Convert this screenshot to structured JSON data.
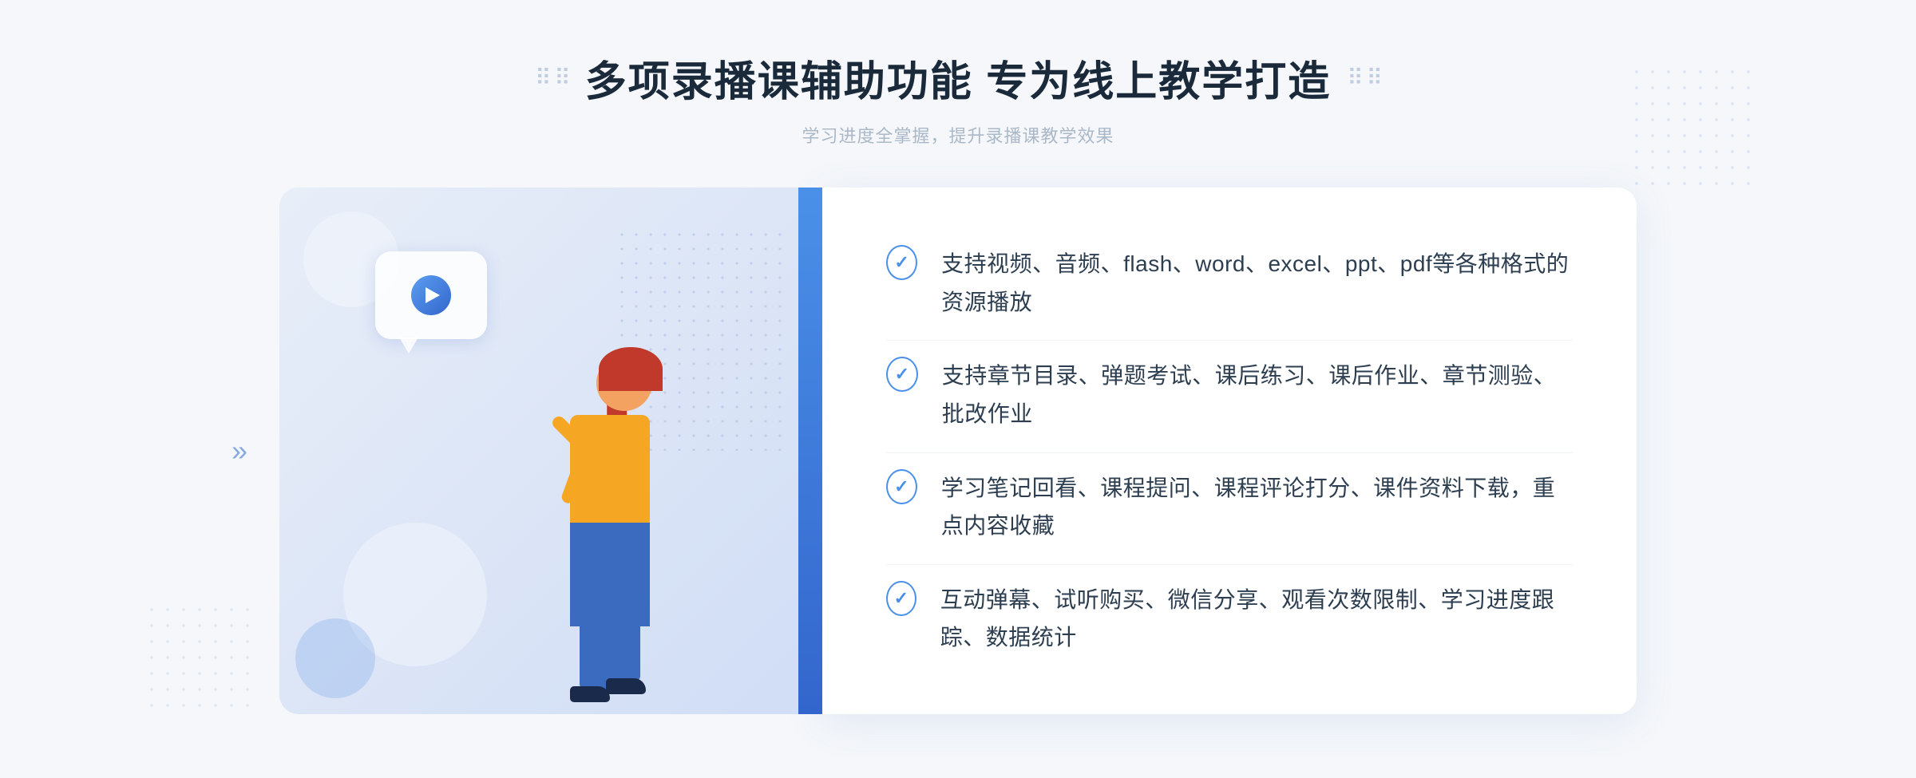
{
  "header": {
    "title": "多项录播课辅助功能 专为线上教学打造",
    "subtitle": "学习进度全掌握，提升录播课教学效果",
    "dots_left": "⠿⠿",
    "dots_right": "⠿⠿"
  },
  "features": [
    {
      "id": "feature-1",
      "text": "支持视频、音频、flash、word、excel、ppt、pdf等各种格式的资源播放"
    },
    {
      "id": "feature-2",
      "text": "支持章节目录、弹题考试、课后练习、课后作业、章节测验、批改作业"
    },
    {
      "id": "feature-3",
      "text": "学习笔记回看、课程提问、课程评论打分、课件资料下载，重点内容收藏"
    },
    {
      "id": "feature-4",
      "text": "互动弹幕、试听购买、微信分享、观看次数限制、学习进度跟踪、数据统计"
    }
  ],
  "illustration": {
    "play_button_label": "▶",
    "arrow_left": "»"
  }
}
